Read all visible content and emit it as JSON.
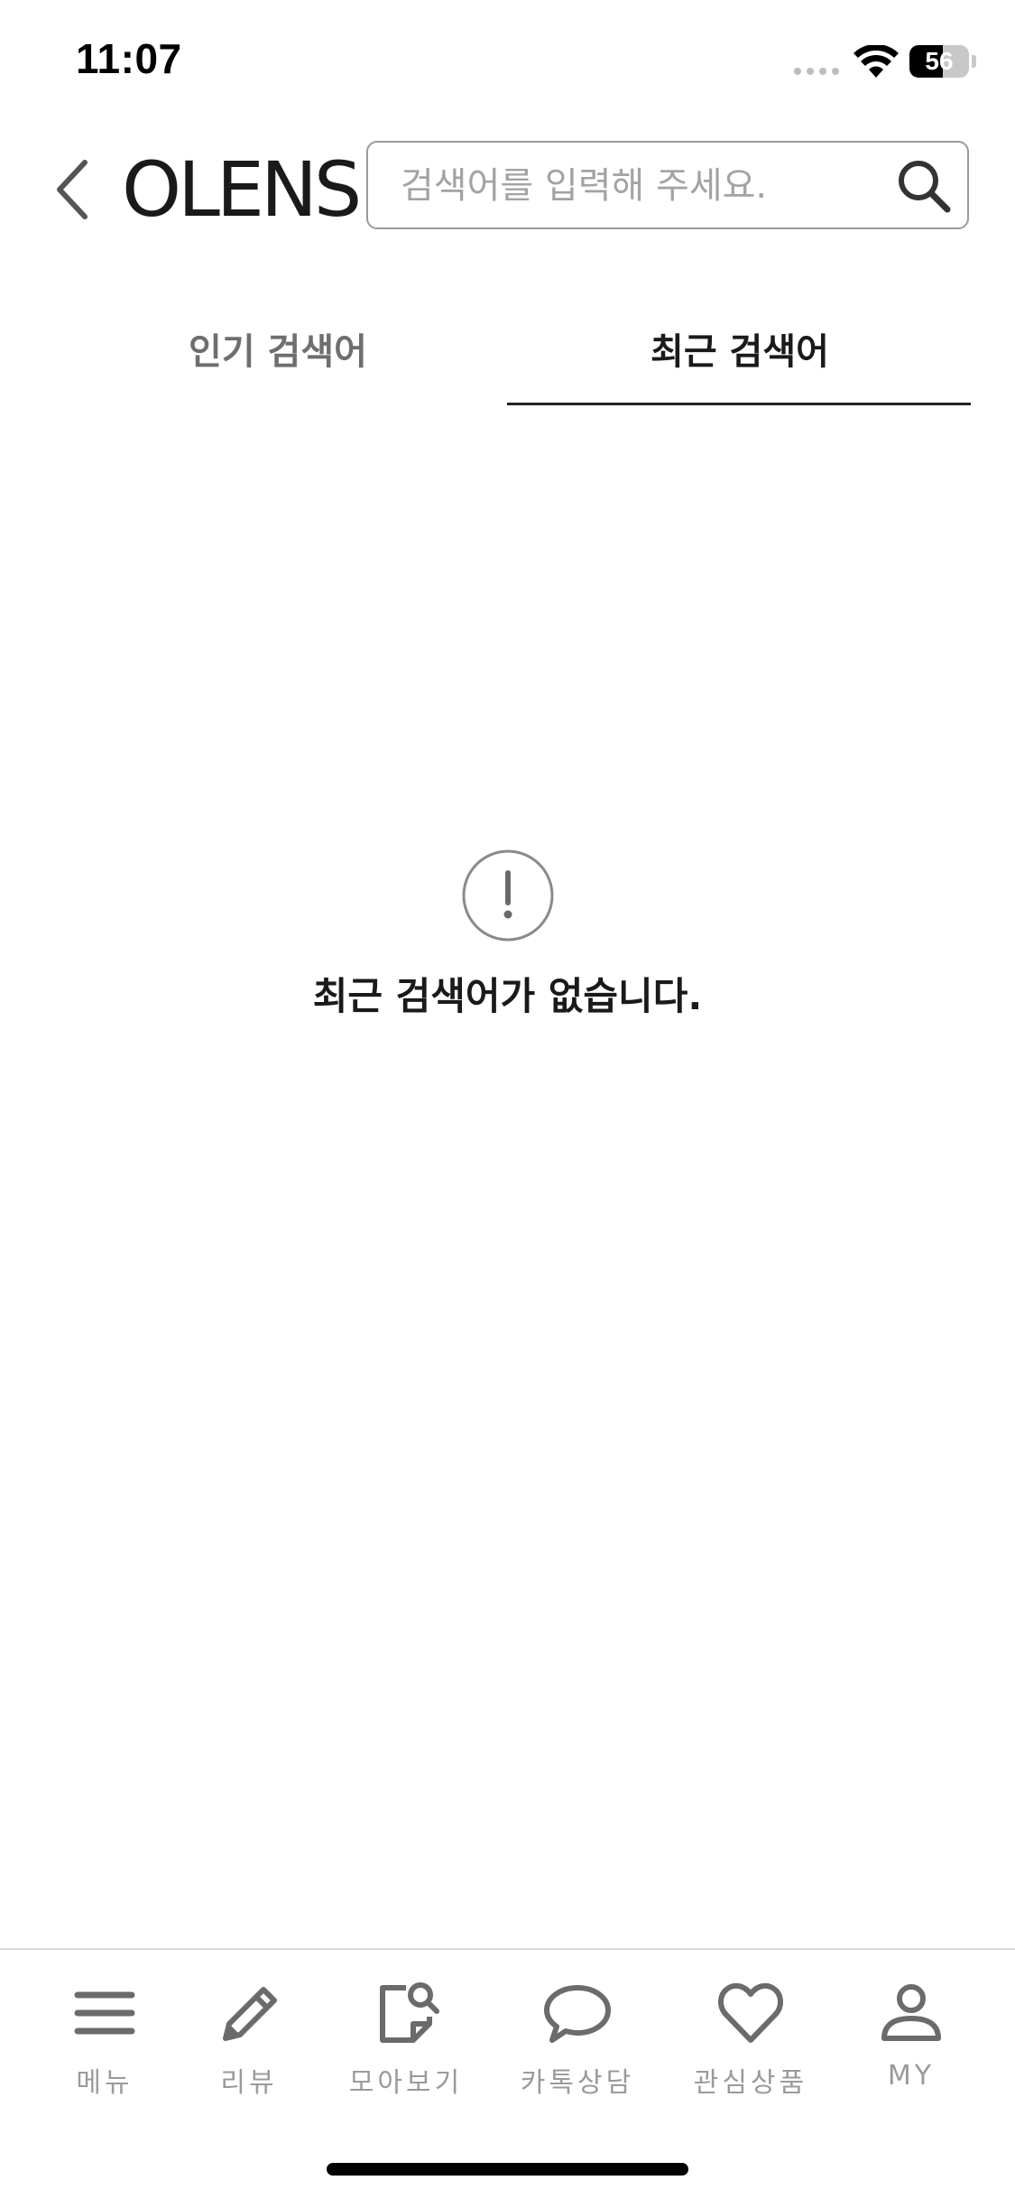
{
  "status_bar": {
    "time": "11:07",
    "battery_level": "56",
    "battery_fraction": 0.56,
    "signal_icon": "cellular-dots-icon",
    "wifi_icon": "wifi-icon"
  },
  "header": {
    "back_icon": "chevron-left-icon",
    "logo_text": "OLENS",
    "search": {
      "placeholder": "검색어를 입력해 주세요.",
      "value": "",
      "icon": "search-icon"
    }
  },
  "tabs": [
    {
      "label": "인기 검색어",
      "active": false
    },
    {
      "label": "최근 검색어",
      "active": true
    }
  ],
  "empty_state": {
    "icon": "exclamation-circle-icon",
    "message": "최근 검색어가 없습니다."
  },
  "bottom_nav": {
    "items": [
      {
        "label": "메뉴",
        "icon": "menu-icon"
      },
      {
        "label": "리뷰",
        "icon": "pencil-icon"
      },
      {
        "label": "모아보기",
        "icon": "collection-search-icon"
      },
      {
        "label": "카톡상담",
        "icon": "chat-bubble-icon"
      },
      {
        "label": "관심상품",
        "icon": "heart-icon"
      },
      {
        "label": "MY",
        "icon": "user-icon"
      }
    ]
  },
  "colors": {
    "primary_text": "#1a1a1a",
    "inactive_tab": "#6e6e6e",
    "icon_gray": "#6b6b6b",
    "nav_label_gray": "#9a9a9a",
    "border_gray": "#9a9a9a"
  }
}
